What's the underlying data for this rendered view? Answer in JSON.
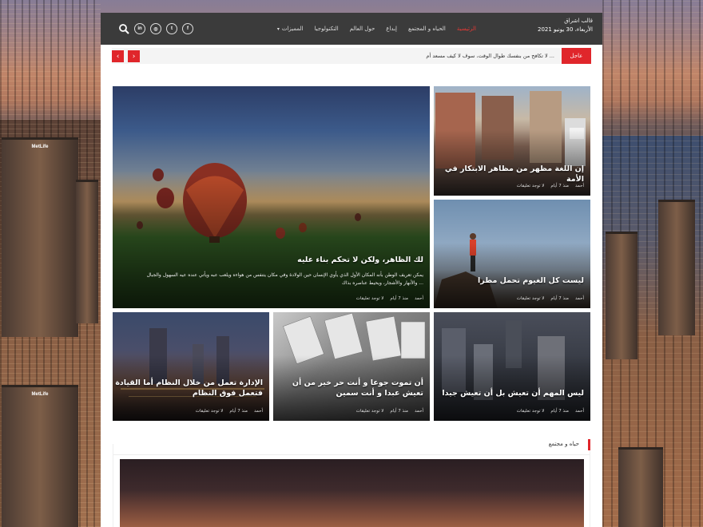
{
  "header": {
    "site_title": "قالب اشراق",
    "date": "الأربعاء، 30 يونيو 2021",
    "nav": [
      {
        "label": "الرئيسية",
        "active": true
      },
      {
        "label": "الحياه و المجتمع",
        "active": false
      },
      {
        "label": "إبداع",
        "active": false
      },
      {
        "label": "حول العالم",
        "active": false
      },
      {
        "label": "التكنولوجيا",
        "active": false
      },
      {
        "label": "المميزات",
        "active": false,
        "dropdown": true
      }
    ],
    "socials": [
      "facebook-icon",
      "twitter-icon",
      "instagram-icon",
      "linkedin-icon"
    ]
  },
  "ticker": {
    "label": "عاجل",
    "text": "لا تكافح من بنفسك طوال الوقت، سوف لا كيف مسعد أم ..."
  },
  "posts": {
    "featured": {
      "title": "لك الظاهر، ولكن لا تحكم بناء عليه",
      "excerpt": "يمكن تعريف الوطن بأنه المكان الأول الذي يأوي الإنسان حين الولادة وفي مكان يتنفس من هواءه ويلعب عبه ويأتي عنده عيه السهول والجبال والأنهار والأشجار، ويحيط عناصره بذاك ...",
      "author": "أحمد",
      "date": "منذ 7 أيام",
      "comments": "لا توجد تعليقات"
    },
    "side_top": {
      "title": "إن اللغة مظهر من مظاهر الابتكار في الأمة",
      "author": "أحمد",
      "date": "منذ 7 أيام",
      "comments": "لا توجد تعليقات"
    },
    "side_mid": {
      "title": "ليست كل الغيوم تحمل مطرا",
      "author": "أحمد",
      "date": "منذ 7 أيام",
      "comments": "لا توجد تعليقات"
    },
    "row_right": {
      "title": "ليس المهم أن تعيش بل أن تعيش جيدا",
      "author": "أحمد",
      "date": "منذ 7 أيام",
      "comments": "لا توجد تعليقات"
    },
    "row_mid": {
      "title": "أن تموت جوعا و أنت حر خير من أن تعيش عبدا و أنت سمين",
      "author": "أحمد",
      "date": "منذ 7 أيام",
      "comments": "لا توجد تعليقات"
    },
    "row_left": {
      "title": "الإدارة تعمل من خلال النظام أما القيادة فتعمل فوق النظام",
      "author": "أحمد",
      "date": "منذ 7 أيام",
      "comments": "لا توجد تعليقات"
    }
  },
  "section": {
    "label": "حياه و مجتمع"
  },
  "colors": {
    "accent": "#e0262b",
    "topbar": "#3b3b3b"
  }
}
